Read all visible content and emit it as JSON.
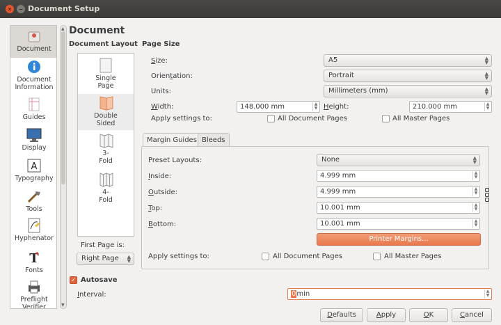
{
  "window": {
    "title": "Document Setup"
  },
  "sidebar": {
    "items": [
      {
        "label": "Document",
        "icon": "document-icon",
        "active": true
      },
      {
        "label": "Document Information",
        "icon": "info-icon"
      },
      {
        "label": "Guides",
        "icon": "guides-icon"
      },
      {
        "label": "Display",
        "icon": "display-icon"
      },
      {
        "label": "Typography",
        "icon": "typography-icon"
      },
      {
        "label": "Tools",
        "icon": "tools-icon"
      },
      {
        "label": "Hyphenator",
        "icon": "hyphenator-icon"
      },
      {
        "label": "Fonts",
        "icon": "fonts-icon"
      },
      {
        "label": "Preflight Verifier",
        "icon": "preflight-icon"
      }
    ]
  },
  "main": {
    "heading": "Document",
    "layout_heading": "Document Layout",
    "page_size_heading": "Page Size",
    "layouts": [
      {
        "label": "Single Page"
      },
      {
        "label": "Double Sided",
        "active": true
      },
      {
        "label": "3-Fold"
      },
      {
        "label": "4-Fold"
      }
    ],
    "first_page_label": "First Page is:",
    "first_page_value": "Right Page",
    "size_label": "Size:",
    "size_value": "A5",
    "orientation_label": "Orientation:",
    "orientation_value": "Portrait",
    "units_label": "Units:",
    "units_value": "Millimeters (mm)",
    "width_label": "Width:",
    "width_value": "148.000 mm",
    "height_label": "Height:",
    "height_value": "210.000 mm",
    "apply_label": "Apply settings to:",
    "all_doc_pages": "All Document Pages",
    "all_master_pages": "All Master Pages"
  },
  "margins": {
    "tab_margin_guides": "Margin Guides",
    "tab_bleeds": "Bleeds",
    "preset_label": "Preset Layouts:",
    "preset_value": "None",
    "inside_label": "Inside:",
    "inside_value": "4.999 mm",
    "outside_label": "Outside:",
    "outside_value": "4.999 mm",
    "top_label": "Top:",
    "top_value": "10.001 mm",
    "bottom_label": "Bottom:",
    "bottom_value": "10.001 mm",
    "printer_margins": "Printer Margins...",
    "apply_label": "Apply settings to:",
    "all_doc_pages": "All Document Pages",
    "all_master_pages": "All Master Pages"
  },
  "autosave": {
    "label": "Autosave",
    "checked": true,
    "interval_label": "Interval:",
    "interval_number": "0",
    "interval_unit": "min"
  },
  "buttons": {
    "defaults": "Defaults",
    "apply": "Apply",
    "ok": "OK",
    "cancel": "Cancel"
  },
  "colors": {
    "accent": "#e9784b",
    "titlebar": "#3c3b37",
    "close": "#e4572e"
  }
}
